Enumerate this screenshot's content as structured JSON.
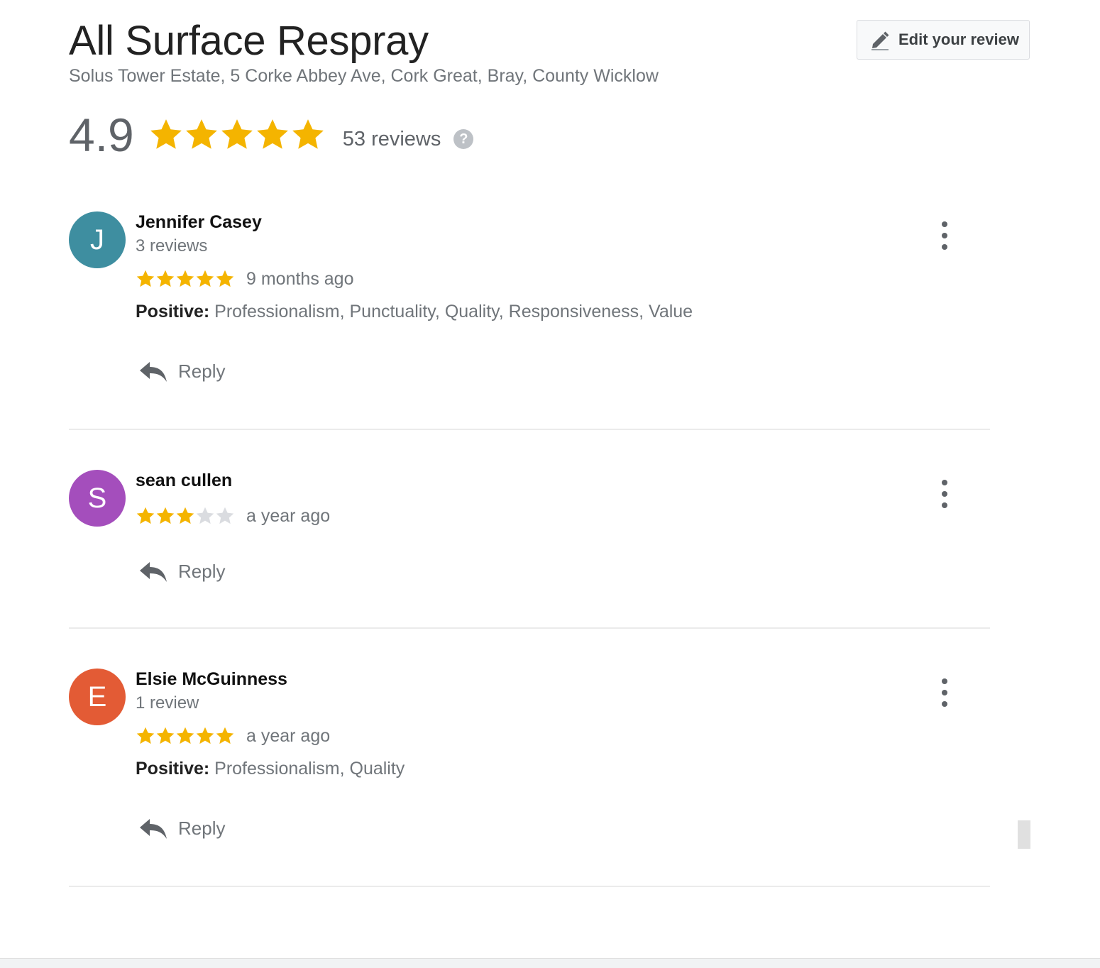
{
  "business": {
    "name": "All Surface Respray",
    "address": "Solus Tower Estate, 5 Corke Abbey Ave, Cork Great, Bray, County Wicklow",
    "rating": "4.9",
    "rating_stars": 5,
    "review_count_label": "53 reviews",
    "help_glyph": "?"
  },
  "edit_review": {
    "label": "Edit your review",
    "icon": "pencil-icon"
  },
  "colors": {
    "star_filled": "#f4b400",
    "star_empty": "#dadce0",
    "text_secondary": "#70757a"
  },
  "reviews": [
    {
      "name": "Jennifer Casey",
      "avatar_initial": "J",
      "avatar_color": "#3e8ea0",
      "reviewer_count": "3 reviews",
      "rating": 5,
      "time": "9 months ago",
      "positive_label": "Positive:",
      "positive_text": "Professionalism, Punctuality, Quality, Responsiveness, Value",
      "reply_label": "Reply"
    },
    {
      "name": "sean cullen",
      "avatar_initial": "S",
      "avatar_color": "#a44ebc",
      "reviewer_count": "",
      "rating": 3,
      "time": "a year ago",
      "positive_label": "",
      "positive_text": "",
      "reply_label": "Reply"
    },
    {
      "name": "Elsie McGuinness",
      "avatar_initial": "E",
      "avatar_color": "#e35b35",
      "reviewer_count": "1 review",
      "rating": 5,
      "time": "a year ago",
      "positive_label": "Positive:",
      "positive_text": "Professionalism, Quality",
      "reply_label": "Reply"
    }
  ]
}
